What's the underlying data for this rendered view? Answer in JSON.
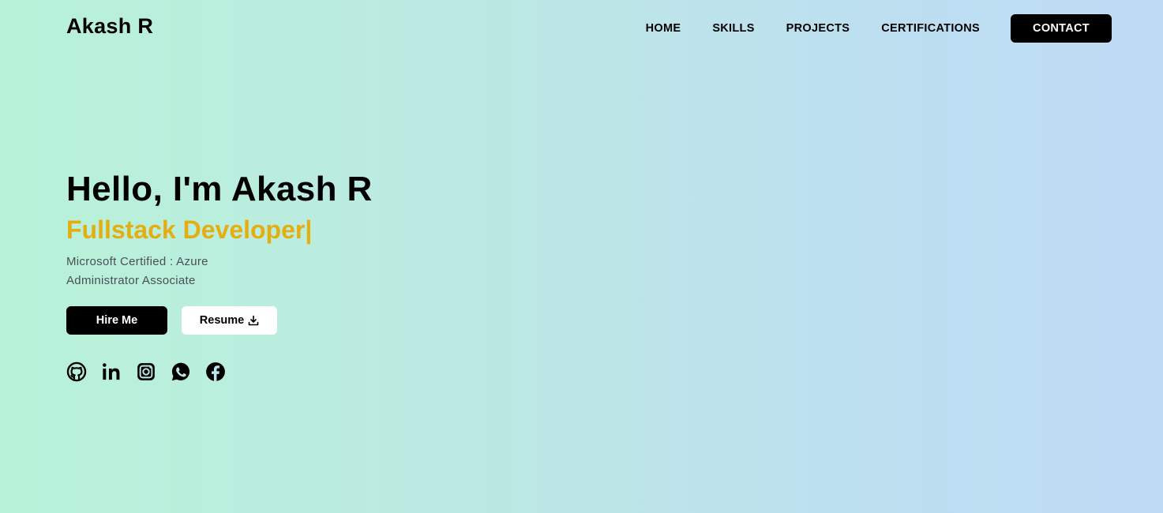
{
  "header": {
    "brand": "Akash R",
    "nav": [
      "HOME",
      "SKILLS",
      "PROJECTS",
      "CERTIFICATIONS"
    ],
    "contact_label": "CONTACT"
  },
  "hero": {
    "greeting": "Hello, I'm Akash R",
    "role": "Fullstack Developer|",
    "desc_line1": "Microsoft Certified : Azure",
    "desc_line2": "Administrator Associate",
    "hire_label": "Hire Me",
    "resume_label": "Resume"
  },
  "socials": [
    "github-icon",
    "linkedin-icon",
    "instagram-icon",
    "whatsapp-icon",
    "facebook-icon"
  ],
  "colors": {
    "accent": "#e5ad0f",
    "button_dark": "#000000",
    "button_light": "#ffffff"
  }
}
